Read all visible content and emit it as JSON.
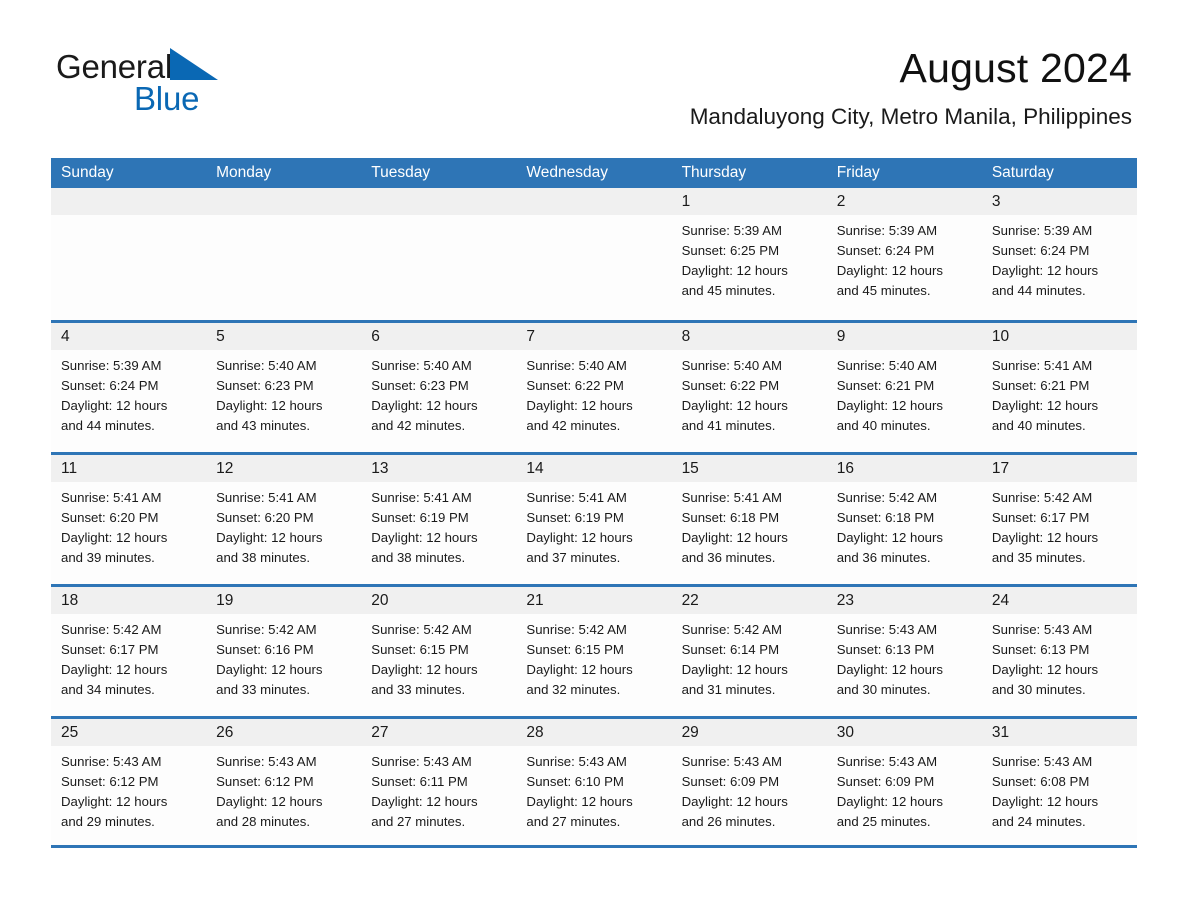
{
  "brand": {
    "name_part1": "General",
    "name_part2": "Blue",
    "triangle_icon": "blue-triangle-icon",
    "accent_color": "#0a68b4"
  },
  "header": {
    "title": "August 2024",
    "subtitle": "Mandaluyong City, Metro Manila, Philippines"
  },
  "theme": {
    "header_blue": "#2e75b6",
    "day_band_gray": "#f0f0f0",
    "text_dark": "#1a1a1a"
  },
  "weekdays": [
    "Sunday",
    "Monday",
    "Tuesday",
    "Wednesday",
    "Thursday",
    "Friday",
    "Saturday"
  ],
  "weeks": [
    [
      {
        "day": "",
        "sunrise": "",
        "sunset": "",
        "daylight1": "",
        "daylight2": ""
      },
      {
        "day": "",
        "sunrise": "",
        "sunset": "",
        "daylight1": "",
        "daylight2": ""
      },
      {
        "day": "",
        "sunrise": "",
        "sunset": "",
        "daylight1": "",
        "daylight2": ""
      },
      {
        "day": "",
        "sunrise": "",
        "sunset": "",
        "daylight1": "",
        "daylight2": ""
      },
      {
        "day": "1",
        "sunrise": "Sunrise: 5:39 AM",
        "sunset": "Sunset: 6:25 PM",
        "daylight1": "Daylight: 12 hours",
        "daylight2": "and 45 minutes."
      },
      {
        "day": "2",
        "sunrise": "Sunrise: 5:39 AM",
        "sunset": "Sunset: 6:24 PM",
        "daylight1": "Daylight: 12 hours",
        "daylight2": "and 45 minutes."
      },
      {
        "day": "3",
        "sunrise": "Sunrise: 5:39 AM",
        "sunset": "Sunset: 6:24 PM",
        "daylight1": "Daylight: 12 hours",
        "daylight2": "and 44 minutes."
      }
    ],
    [
      {
        "day": "4",
        "sunrise": "Sunrise: 5:39 AM",
        "sunset": "Sunset: 6:24 PM",
        "daylight1": "Daylight: 12 hours",
        "daylight2": "and 44 minutes."
      },
      {
        "day": "5",
        "sunrise": "Sunrise: 5:40 AM",
        "sunset": "Sunset: 6:23 PM",
        "daylight1": "Daylight: 12 hours",
        "daylight2": "and 43 minutes."
      },
      {
        "day": "6",
        "sunrise": "Sunrise: 5:40 AM",
        "sunset": "Sunset: 6:23 PM",
        "daylight1": "Daylight: 12 hours",
        "daylight2": "and 42 minutes."
      },
      {
        "day": "7",
        "sunrise": "Sunrise: 5:40 AM",
        "sunset": "Sunset: 6:22 PM",
        "daylight1": "Daylight: 12 hours",
        "daylight2": "and 42 minutes."
      },
      {
        "day": "8",
        "sunrise": "Sunrise: 5:40 AM",
        "sunset": "Sunset: 6:22 PM",
        "daylight1": "Daylight: 12 hours",
        "daylight2": "and 41 minutes."
      },
      {
        "day": "9",
        "sunrise": "Sunrise: 5:40 AM",
        "sunset": "Sunset: 6:21 PM",
        "daylight1": "Daylight: 12 hours",
        "daylight2": "and 40 minutes."
      },
      {
        "day": "10",
        "sunrise": "Sunrise: 5:41 AM",
        "sunset": "Sunset: 6:21 PM",
        "daylight1": "Daylight: 12 hours",
        "daylight2": "and 40 minutes."
      }
    ],
    [
      {
        "day": "11",
        "sunrise": "Sunrise: 5:41 AM",
        "sunset": "Sunset: 6:20 PM",
        "daylight1": "Daylight: 12 hours",
        "daylight2": "and 39 minutes."
      },
      {
        "day": "12",
        "sunrise": "Sunrise: 5:41 AM",
        "sunset": "Sunset: 6:20 PM",
        "daylight1": "Daylight: 12 hours",
        "daylight2": "and 38 minutes."
      },
      {
        "day": "13",
        "sunrise": "Sunrise: 5:41 AM",
        "sunset": "Sunset: 6:19 PM",
        "daylight1": "Daylight: 12 hours",
        "daylight2": "and 38 minutes."
      },
      {
        "day": "14",
        "sunrise": "Sunrise: 5:41 AM",
        "sunset": "Sunset: 6:19 PM",
        "daylight1": "Daylight: 12 hours",
        "daylight2": "and 37 minutes."
      },
      {
        "day": "15",
        "sunrise": "Sunrise: 5:41 AM",
        "sunset": "Sunset: 6:18 PM",
        "daylight1": "Daylight: 12 hours",
        "daylight2": "and 36 minutes."
      },
      {
        "day": "16",
        "sunrise": "Sunrise: 5:42 AM",
        "sunset": "Sunset: 6:18 PM",
        "daylight1": "Daylight: 12 hours",
        "daylight2": "and 36 minutes."
      },
      {
        "day": "17",
        "sunrise": "Sunrise: 5:42 AM",
        "sunset": "Sunset: 6:17 PM",
        "daylight1": "Daylight: 12 hours",
        "daylight2": "and 35 minutes."
      }
    ],
    [
      {
        "day": "18",
        "sunrise": "Sunrise: 5:42 AM",
        "sunset": "Sunset: 6:17 PM",
        "daylight1": "Daylight: 12 hours",
        "daylight2": "and 34 minutes."
      },
      {
        "day": "19",
        "sunrise": "Sunrise: 5:42 AM",
        "sunset": "Sunset: 6:16 PM",
        "daylight1": "Daylight: 12 hours",
        "daylight2": "and 33 minutes."
      },
      {
        "day": "20",
        "sunrise": "Sunrise: 5:42 AM",
        "sunset": "Sunset: 6:15 PM",
        "daylight1": "Daylight: 12 hours",
        "daylight2": "and 33 minutes."
      },
      {
        "day": "21",
        "sunrise": "Sunrise: 5:42 AM",
        "sunset": "Sunset: 6:15 PM",
        "daylight1": "Daylight: 12 hours",
        "daylight2": "and 32 minutes."
      },
      {
        "day": "22",
        "sunrise": "Sunrise: 5:42 AM",
        "sunset": "Sunset: 6:14 PM",
        "daylight1": "Daylight: 12 hours",
        "daylight2": "and 31 minutes."
      },
      {
        "day": "23",
        "sunrise": "Sunrise: 5:43 AM",
        "sunset": "Sunset: 6:13 PM",
        "daylight1": "Daylight: 12 hours",
        "daylight2": "and 30 minutes."
      },
      {
        "day": "24",
        "sunrise": "Sunrise: 5:43 AM",
        "sunset": "Sunset: 6:13 PM",
        "daylight1": "Daylight: 12 hours",
        "daylight2": "and 30 minutes."
      }
    ],
    [
      {
        "day": "25",
        "sunrise": "Sunrise: 5:43 AM",
        "sunset": "Sunset: 6:12 PM",
        "daylight1": "Daylight: 12 hours",
        "daylight2": "and 29 minutes."
      },
      {
        "day": "26",
        "sunrise": "Sunrise: 5:43 AM",
        "sunset": "Sunset: 6:12 PM",
        "daylight1": "Daylight: 12 hours",
        "daylight2": "and 28 minutes."
      },
      {
        "day": "27",
        "sunrise": "Sunrise: 5:43 AM",
        "sunset": "Sunset: 6:11 PM",
        "daylight1": "Daylight: 12 hours",
        "daylight2": "and 27 minutes."
      },
      {
        "day": "28",
        "sunrise": "Sunrise: 5:43 AM",
        "sunset": "Sunset: 6:10 PM",
        "daylight1": "Daylight: 12 hours",
        "daylight2": "and 27 minutes."
      },
      {
        "day": "29",
        "sunrise": "Sunrise: 5:43 AM",
        "sunset": "Sunset: 6:09 PM",
        "daylight1": "Daylight: 12 hours",
        "daylight2": "and 26 minutes."
      },
      {
        "day": "30",
        "sunrise": "Sunrise: 5:43 AM",
        "sunset": "Sunset: 6:09 PM",
        "daylight1": "Daylight: 12 hours",
        "daylight2": "and 25 minutes."
      },
      {
        "day": "31",
        "sunrise": "Sunrise: 5:43 AM",
        "sunset": "Sunset: 6:08 PM",
        "daylight1": "Daylight: 12 hours",
        "daylight2": "and 24 minutes."
      }
    ]
  ]
}
